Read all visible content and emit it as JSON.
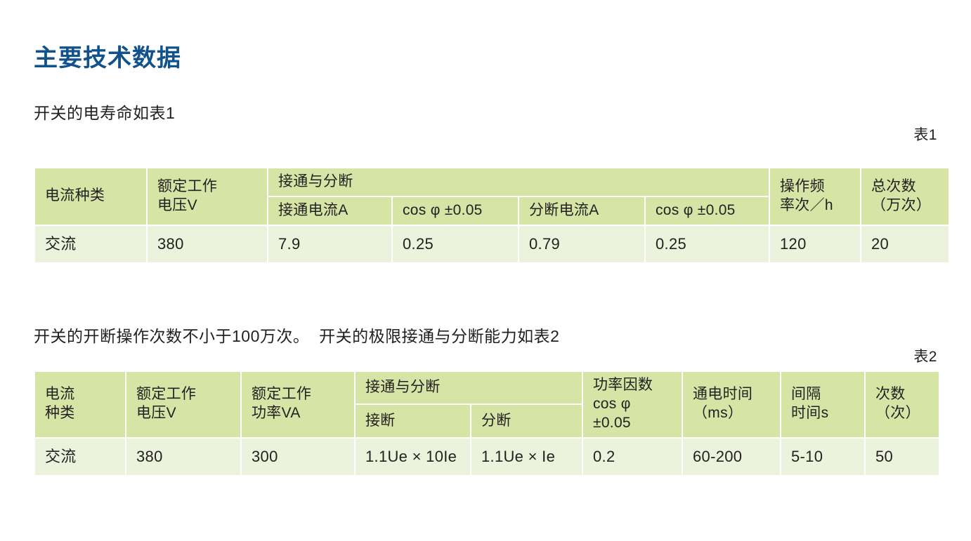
{
  "page": {
    "title": "主要技术数据"
  },
  "intro": {
    "line1": "开关的电寿命如表1",
    "line2": "开关的开断操作次数不小于100万次。  开关的极限接通与分断能力如表2"
  },
  "captions": {
    "table1": "表1",
    "table2": "表2"
  },
  "colors": {
    "title": "#12528c",
    "header_cell": "#d6e5a6",
    "data_cell": "#ecf3dd",
    "text": "#231f20",
    "page_background": "#ffffff"
  },
  "table1": {
    "caption": "表1",
    "headers": {
      "current_type": "电流种类",
      "rated_voltage_l1": "额定工作",
      "rated_voltage_l2": "电压V",
      "make_break_group": "接通与分断",
      "make_current": "接通电流A",
      "cos_phi_make": "cos φ ±0.05",
      "break_current": "分断电流A",
      "cos_phi_break": "cos φ ±0.05",
      "operating_freq_l1": "操作频",
      "operating_freq_l2": "率次／h",
      "total_count_l1": "总次数",
      "total_count_l2": "（万次）"
    },
    "row": {
      "current_type": "交流",
      "rated_voltage": "380",
      "make_current": "7.9",
      "cos_phi_make": "0.25",
      "break_current": "0.79",
      "cos_phi_break": "0.25",
      "operating_freq": "120",
      "total_count": "20"
    }
  },
  "table2": {
    "caption": "表2",
    "headers": {
      "current_type_l1": "电流",
      "current_type_l2": "种类",
      "rated_voltage_l1": "额定工作",
      "rated_voltage_l2": "电压V",
      "rated_power_l1": "额定工作",
      "rated_power_l2": "功率VA",
      "make_break_group": "接通与分断",
      "make": "接断",
      "break": "分断",
      "power_factor_l1": "功率因数",
      "power_factor_l2": "cos φ",
      "power_factor_l3": "±0.05",
      "on_time_l1": "通电时间",
      "on_time_l2": "（ms）",
      "interval_l1": "间隔",
      "interval_l2": "时间s",
      "count_l1": "次数",
      "count_l2": "（次）"
    },
    "row": {
      "current_type": "交流",
      "rated_voltage": "380",
      "rated_power": "300",
      "make": "1.1Ue × 10Ie",
      "break": "1.1Ue × Ie",
      "power_factor": "0.2",
      "on_time": "60-200",
      "interval": "5-10",
      "count": "50"
    }
  }
}
